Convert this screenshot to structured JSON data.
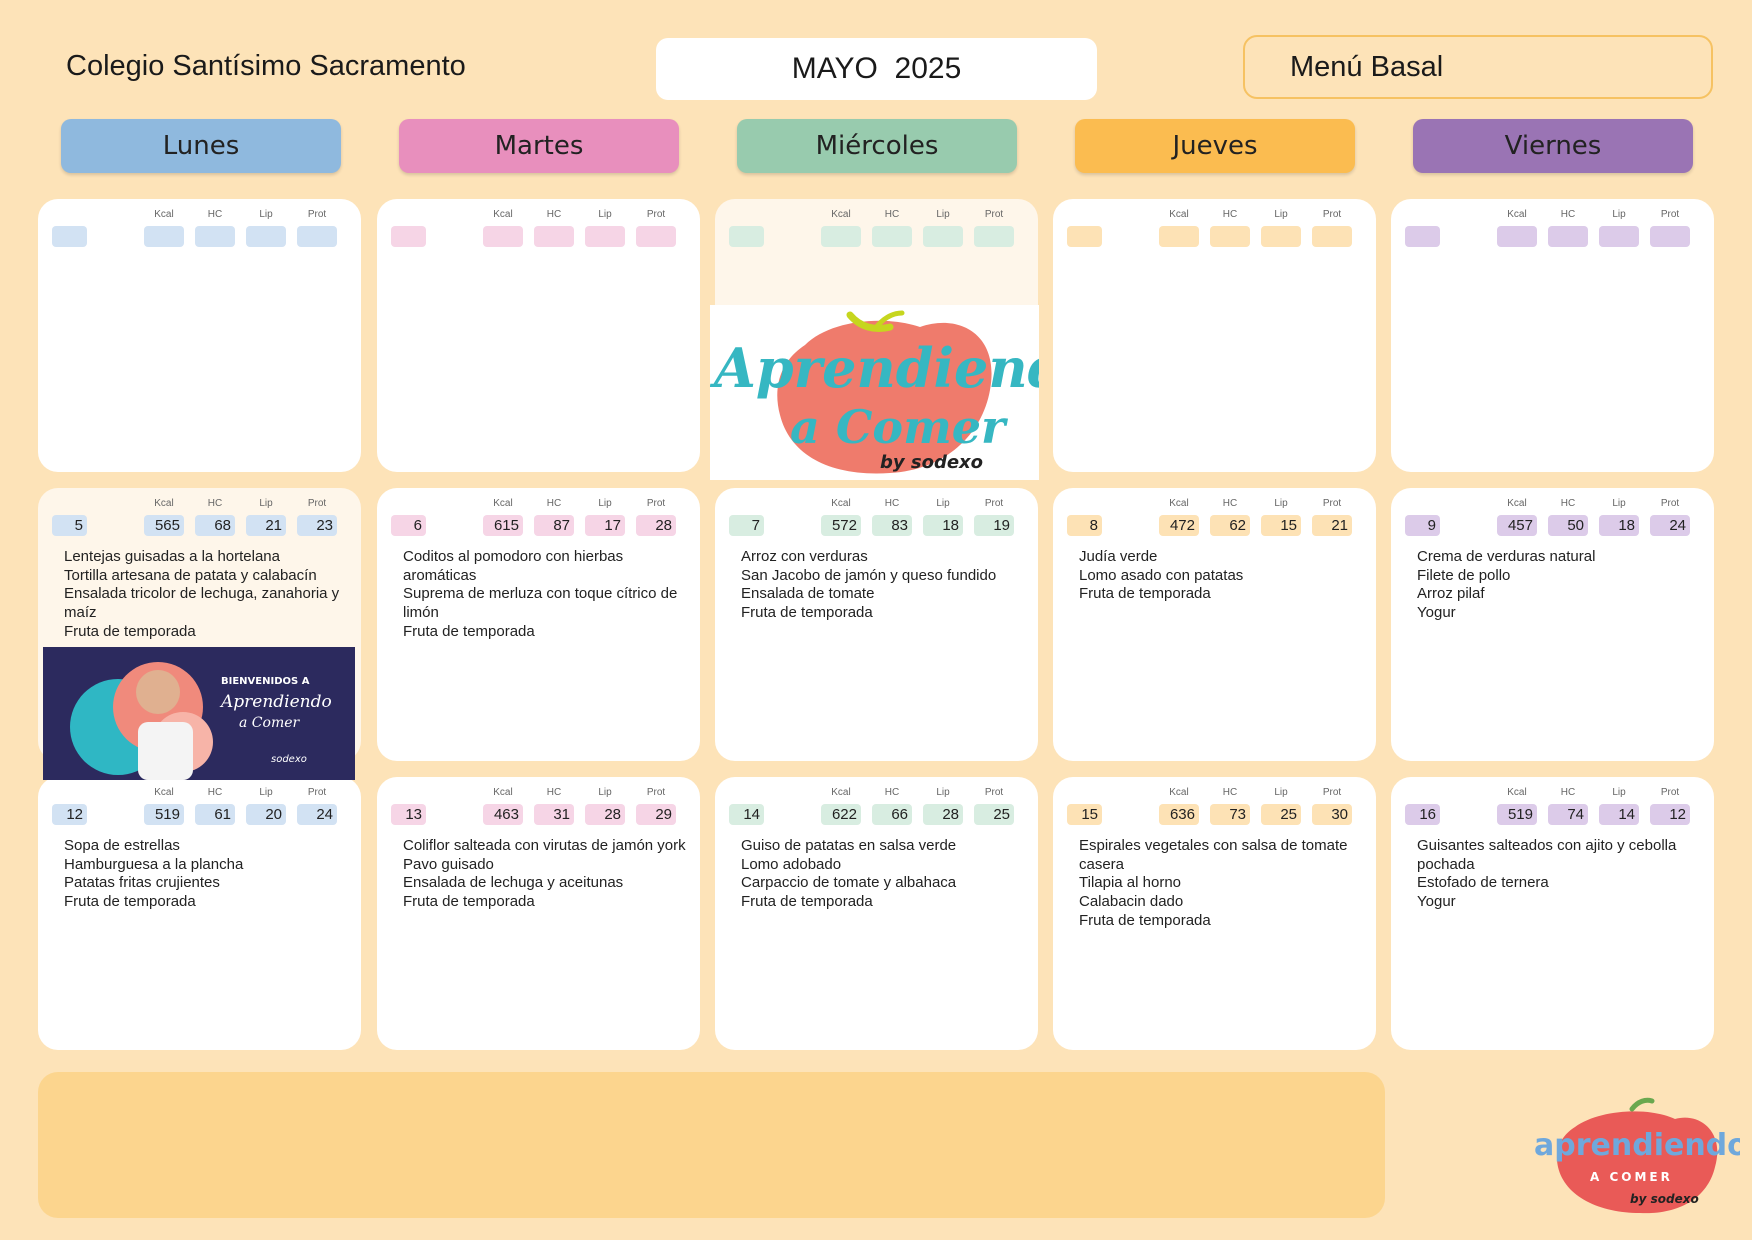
{
  "header": {
    "school": "Colegio Santísimo Sacramento",
    "month": "MAYO  2025",
    "menu_type": "Menú Basal"
  },
  "days": [
    {
      "name": "Lunes",
      "color": "#8fb9de",
      "chip": "#d2e2f3"
    },
    {
      "name": "Martes",
      "color": "#e88fbd",
      "chip": "#f6d5e6"
    },
    {
      "name": "Miércoles",
      "color": "#98cbae",
      "chip": "#d8ede1"
    },
    {
      "name": "Jueves",
      "color": "#fbbc50",
      "chip": "#fde2b5"
    },
    {
      "name": "Viernes",
      "color": "#9a74b4",
      "chip": "#dccbe9"
    }
  ],
  "nutrient_labels": [
    "Kcal",
    "HC",
    "Lip",
    "Prot"
  ],
  "weeks": [
    [
      {
        "date": "",
        "values": [
          "",
          "",
          "",
          ""
        ],
        "dishes": []
      },
      {
        "date": "",
        "values": [
          "",
          "",
          "",
          ""
        ],
        "dishes": []
      },
      {
        "date": "",
        "values": [
          "",
          "",
          "",
          ""
        ],
        "dishes": []
      },
      {
        "date": "",
        "values": [
          "",
          "",
          "",
          ""
        ],
        "dishes": []
      },
      {
        "date": "",
        "values": [
          "",
          "",
          "",
          ""
        ],
        "dishes": []
      }
    ],
    [
      {
        "date": "5",
        "values": [
          "565",
          "68",
          "21",
          "23"
        ],
        "dishes": [
          "Lentejas guisadas a la hortelana",
          "Tortilla artesana de patata y calabacín",
          "Ensalada tricolor de lechuga, zanahoria y maíz",
          "Fruta de temporada"
        ]
      },
      {
        "date": "6",
        "values": [
          "615",
          "87",
          "17",
          "28"
        ],
        "dishes": [
          "Coditos al pomodoro con hierbas aromáticas",
          "Suprema de merluza con toque cítrico de limón",
          "Fruta de temporada"
        ]
      },
      {
        "date": "7",
        "values": [
          "572",
          "83",
          "18",
          "19"
        ],
        "dishes": [
          "Arroz con verduras",
          "San Jacobo de jamón y queso fundido",
          "Ensalada de tomate",
          "Fruta de temporada"
        ]
      },
      {
        "date": "8",
        "values": [
          "472",
          "62",
          "15",
          "21"
        ],
        "dishes": [
          "Judía verde",
          "Lomo asado con patatas",
          "Fruta de temporada"
        ]
      },
      {
        "date": "9",
        "values": [
          "457",
          "50",
          "18",
          "24"
        ],
        "dishes": [
          "Crema de verduras natural",
          "Filete de pollo",
          "Arroz pilaf",
          "Yogur"
        ]
      }
    ],
    [
      {
        "date": "12",
        "values": [
          "519",
          "61",
          "20",
          "24"
        ],
        "dishes": [
          "Sopa de estrellas",
          "Hamburguesa a la plancha",
          "Patatas fritas crujientes",
          "Fruta de temporada"
        ]
      },
      {
        "date": "13",
        "values": [
          "463",
          "31",
          "28",
          "29"
        ],
        "dishes": [
          "Coliflor salteada con virutas de jamón york",
          "Pavo guisado",
          "Ensalada de lechuga y aceitunas",
          "Fruta de temporada"
        ]
      },
      {
        "date": "14",
        "values": [
          "622",
          "66",
          "28",
          "25"
        ],
        "dishes": [
          "Guiso de patatas en salsa verde",
          "Lomo adobado",
          "Carpaccio de tomate y albahaca",
          "Fruta de temporada"
        ]
      },
      {
        "date": "15",
        "values": [
          "636",
          "73",
          "25",
          "30"
        ],
        "dishes": [
          "Espirales vegetales con salsa de tomate casera",
          "Tilapia al horno",
          "Calabacin dado",
          "Fruta de temporada"
        ]
      },
      {
        "date": "16",
        "values": [
          "519",
          "74",
          "14",
          "12"
        ],
        "dishes": [
          "Guisantes salteados con ajito y cebolla pochada",
          "Estofado de ternera",
          "Yogur"
        ]
      }
    ]
  ],
  "logo_big": {
    "word1": "Aprendiendo",
    "word2": "a Comer",
    "by": "by sodexo"
  },
  "banner": {
    "line1": "BIENVENIDOS A",
    "line2": "Aprendiendo",
    "line3": "a Comer",
    "brand": "sodexo"
  },
  "logo_small": {
    "word1": "aprendiendo",
    "word2": "A COMER",
    "by": "by sodexo"
  }
}
